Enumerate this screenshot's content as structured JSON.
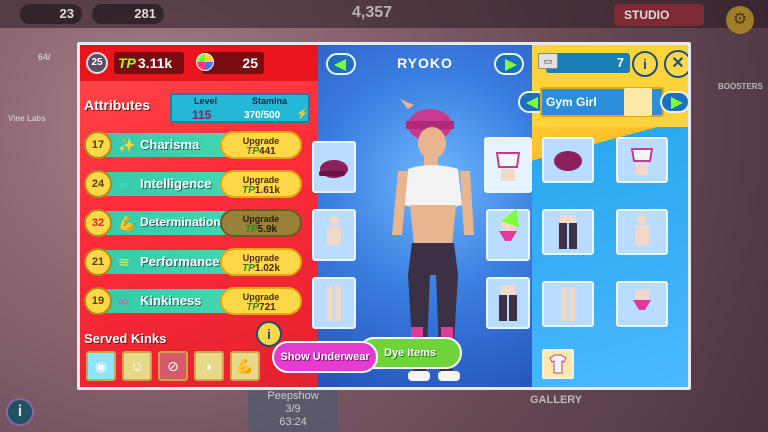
{
  "background": {
    "chips": [
      "23",
      "281"
    ],
    "score": "4,357",
    "studio_label": "STUDIO",
    "side_labels": [
      "BOOSTERS",
      "Vine Labs"
    ],
    "peepshow": {
      "label": "Peepshow",
      "progress": "3/9",
      "time": "63:24"
    },
    "gallery_label": "GALLERY",
    "hearts_small": "64/"
  },
  "header": {
    "level_badge": "25",
    "tp_prefix": "TP",
    "tp_value": "3.11k",
    "coins_value": "25",
    "character_name": "RYOKO",
    "tickets_value": "7"
  },
  "attributes": {
    "title": "Attributes",
    "level_label": "Level",
    "level_value": "115",
    "stamina_label": "Stamina",
    "stamina_value": "370/500",
    "rows": [
      {
        "level": "17",
        "name": "Charisma",
        "icon": "sparkle-icon",
        "upgrade_label": "Upgrade",
        "cost": "441",
        "available": true
      },
      {
        "level": "24",
        "name": "Intelligence",
        "icon": "book-icon",
        "upgrade_label": "Upgrade",
        "cost": "1.61k",
        "available": true
      },
      {
        "level": "32",
        "name": "Determination",
        "icon": "muscle-icon",
        "upgrade_label": "Upgrade",
        "cost": "5.9k",
        "available": false
      },
      {
        "level": "21",
        "name": "Performance",
        "icon": "wave-icon",
        "upgrade_label": "Upgrade",
        "cost": "1.02k",
        "available": true
      },
      {
        "level": "19",
        "name": "Kinkiness",
        "icon": "cuffs-icon",
        "upgrade_label": "Upgrade",
        "cost": "721",
        "available": true
      }
    ]
  },
  "kinks": {
    "title": "Served Kinks",
    "items": [
      "wig-kink-icon",
      "mask-kink-icon",
      "blocked-kink-icon",
      "foot-kink-icon",
      "muscle-kink-icon"
    ]
  },
  "outfit": {
    "name": "Gym Girl"
  },
  "buttons": {
    "dye": "Dye Items",
    "underwear": "Show Underwear"
  },
  "colors": {
    "left_panel": "#ff2d3a",
    "center_panel": "#3b7fe0",
    "right_panel": "#4bb8ff",
    "accent_yellow": "#ffd84a",
    "accent_green": "#7dff3a",
    "accent_pink": "#e43cd0"
  }
}
